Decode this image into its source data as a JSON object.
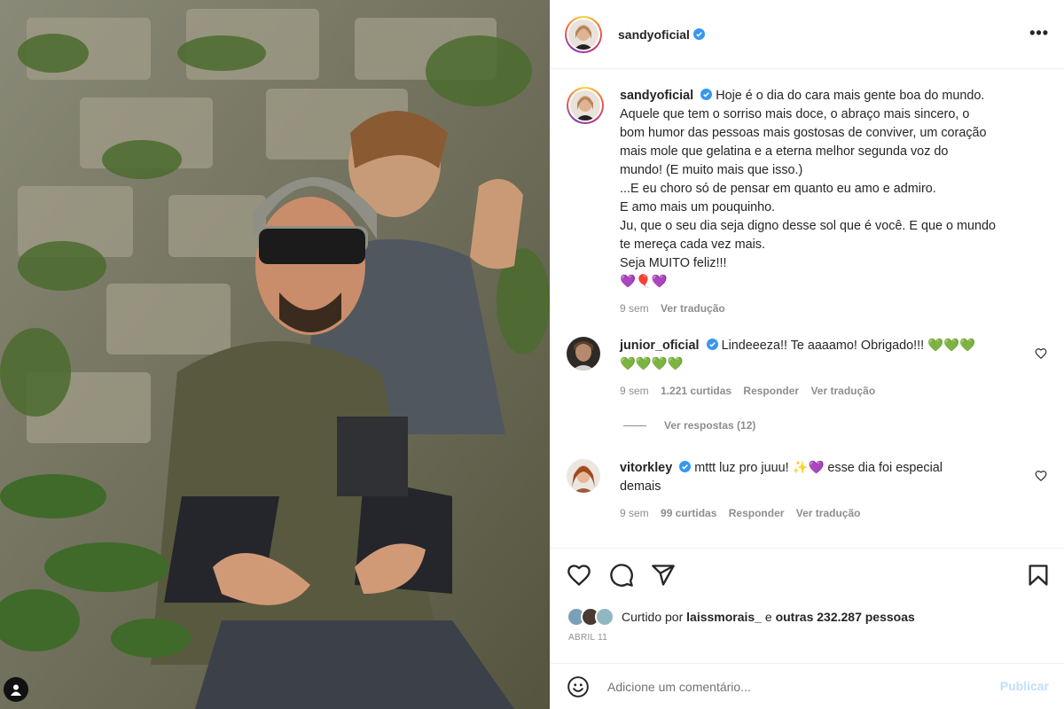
{
  "post": {
    "author": "sandyoficial",
    "more_label": "•••"
  },
  "caption": {
    "username": "sandyoficial",
    "lines": [
      "Hoje é o dia do cara mais gente boa do mundo.",
      "Aquele que tem o sorriso mais doce, o abraço mais sincero, o",
      "bom humor das pessoas mais gostosas de conviver, um coração",
      "mais mole que gelatina e a eterna melhor segunda voz do",
      "mundo! (E muito mais que isso.)",
      "...E eu choro só de pensar em quanto eu amo e admiro.",
      "E amo mais um pouquinho.",
      "Ju, que o seu dia seja digno desse sol que é você. E que o mundo",
      "te mereça cada vez mais.",
      "Seja MUITO feliz!!!",
      "💜🎈💜"
    ],
    "time": "9 sem",
    "translate": "Ver tradução"
  },
  "comments": [
    {
      "username": "junior_oficial",
      "text": "Lindeeeza!! Te aaaamo! Obrigado!!! 💚💚💚",
      "text2": "💚💚💚💚",
      "time": "9 sem",
      "likes": "1.221 curtidas",
      "reply": "Responder",
      "translate": "Ver tradução"
    },
    {
      "username": "vitorkley",
      "text": "mttt luz pro juuu! ✨💜 esse dia foi especial",
      "text2": "demais",
      "time": "9 sem",
      "likes": "99 curtidas",
      "reply": "Responder",
      "translate": "Ver tradução"
    }
  ],
  "view_replies": "Ver respostas (12)",
  "likes": {
    "prefix": "Curtido por",
    "user": "laissmorais_",
    "middle": "e",
    "others": "outras 232.287 pessoas"
  },
  "date": "ABRIL 11",
  "comment_box": {
    "placeholder": "Adicione um comentário...",
    "publish": "Publicar"
  },
  "colors": {
    "verified": "#3897f0",
    "border": "#efefef",
    "muted": "#8e8e8e",
    "publish_disabled": "#c0dffd"
  },
  "icons": [
    "heart-icon",
    "comment-icon",
    "share-icon",
    "bookmark-icon",
    "emoji-icon",
    "verified-icon",
    "more-icon",
    "user-tag-icon"
  ]
}
